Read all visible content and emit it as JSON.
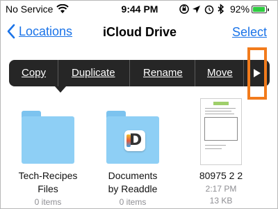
{
  "status_bar": {
    "carrier": "No Service",
    "time": "9:44 PM",
    "battery_percent": "92%",
    "battery_level": 0.92,
    "icons": [
      "wifi-icon",
      "orientation-lock-icon",
      "location-arrow-icon",
      "alarm-icon",
      "bluetooth-icon",
      "battery-icon"
    ]
  },
  "nav": {
    "back_label": "Locations",
    "title": "iCloud Drive",
    "select_label": "Select"
  },
  "edit_menu": {
    "items": [
      "Copy",
      "Duplicate",
      "Rename",
      "Move"
    ],
    "more_icon": "triangle-right-icon"
  },
  "highlight_color": "#f27b1c",
  "files": [
    {
      "name_line1": "Tech-Recipes",
      "name_line2": "Files",
      "meta": "0 items",
      "type": "folder"
    },
    {
      "name_line1": "Documents",
      "name_line2": "by Readdle",
      "meta": "0 items",
      "type": "folder"
    },
    {
      "name_line1": "80975 2 2",
      "meta_line1": "2:17 PM",
      "meta_line2": "13 KB",
      "type": "document"
    }
  ],
  "colors": {
    "accent": "#1a73e8",
    "folder": "#8ecff5",
    "menu_bg": "#262626"
  }
}
